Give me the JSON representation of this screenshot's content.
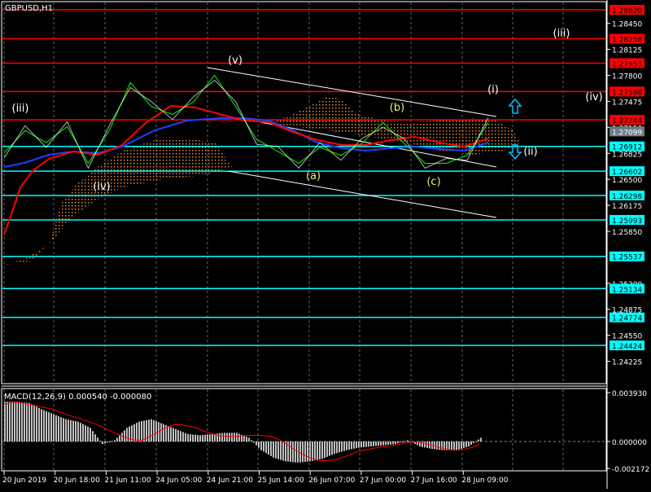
{
  "window": {
    "title": "GBPUSD,H1"
  },
  "colors": {
    "bg": "#000000",
    "grid": "#8a8a8a",
    "resistance": "#ff0000",
    "support": "#00ffff",
    "bid": "#6e7b87",
    "ma_fast": "#ff0000",
    "ma_slow": "#2040ff",
    "price": "#00ff00",
    "cloud": "#e8883a",
    "wave_primary": "#ffffff",
    "wave_minor": "#f0f070",
    "macd_hist": "#c0c0c0",
    "macd_signal": "#ff0000"
  },
  "price_axis": {
    "range": [
      1.2412,
      1.2874
    ],
    "ticks": [
      "1.28450",
      "1.28125",
      "1.27800",
      "1.27475",
      "1.27150",
      "1.26825",
      "1.26500",
      "1.26175",
      "1.25850",
      "1.25200",
      "1.24875",
      "1.24550",
      "1.24225"
    ],
    "resistance_levels": [
      "1.28620",
      "1.28258",
      "1.27953",
      "1.27598",
      "1.27244"
    ],
    "current_price": "1.27099",
    "support_levels": [
      "1.26912",
      "1.26602",
      "1.26298",
      "1.25993",
      "1.25537",
      "1.25134",
      "1.24774",
      "1.24424"
    ]
  },
  "wave_labels": [
    {
      "text": "(iii)",
      "style": "primary"
    },
    {
      "text": "(iv)",
      "style": "primary"
    },
    {
      "text": "(v)",
      "style": "primary"
    },
    {
      "text": "(a)",
      "style": "minor"
    },
    {
      "text": "(b)",
      "style": "minor"
    },
    {
      "text": "(c)",
      "style": "minor"
    },
    {
      "text": "(i)",
      "style": "primary"
    },
    {
      "text": "(ii)",
      "style": "primary"
    },
    {
      "text": "(iii)",
      "style": "primary"
    },
    {
      "text": "(iv)",
      "style": "primary"
    }
  ],
  "chart_data": {
    "type": "line",
    "symbol": "GBPUSD",
    "timeframe": "H1",
    "price_close_samples": [
      1.2683,
      1.2711,
      1.2696,
      1.2716,
      1.267,
      1.2711,
      1.2771,
      1.2741,
      1.2731,
      1.2747,
      1.278,
      1.2741,
      1.27,
      1.2685,
      1.267,
      1.269,
      1.268,
      1.2695,
      1.2721,
      1.2695,
      1.267,
      1.267,
      1.268,
      1.2721
    ],
    "x_labels": [
      "20 Jun 2019",
      "20 Jun 18:00",
      "21 Jun 11:00",
      "24 Jun 05:00",
      "24 Jun 21:00",
      "25 Jun 14:00",
      "26 Jun 07:00",
      "27 Jun 00:00",
      "27 Jun 16:00",
      "28 Jun 09:00"
    ]
  },
  "macd": {
    "title": "MACD(12,26,9) 0.000540 -0.000080",
    "axis_labels": [
      "0.003930",
      "0.000000",
      "-0.002172"
    ],
    "range": [
      -0.002172,
      0.00393
    ],
    "histogram_samples": [
      0.0032,
      0.0032,
      0.0031,
      0.0026,
      0.0022,
      0.0018,
      0.0016,
      0.0011,
      -0.0002,
      0.0001,
      0.0011,
      0.0016,
      0.0018,
      0.0014,
      0.001,
      0.0006,
      0.0005,
      0.0006,
      0.0007,
      0.0007,
      0.0003,
      -0.0007,
      -0.0013,
      -0.0016,
      -0.0017,
      -0.0016,
      -0.0014,
      -0.001,
      -0.0007,
      -0.0005,
      -0.0004,
      -0.0003,
      -0.0002,
      0.0001,
      -0.0004,
      -0.0006,
      -0.0007,
      -0.0007,
      -0.0004,
      0.0003
    ],
    "signal_samples": [
      0.003,
      0.0032,
      0.003,
      0.0028,
      0.0026,
      0.0022,
      0.0019,
      0.0016,
      0.0012,
      0.0007,
      0.0003,
      0.0,
      0.0004,
      0.001,
      0.0014,
      0.0013,
      0.001,
      0.0006,
      0.0004,
      0.0004,
      0.0005,
      0.0005,
      0.0004,
      -0.0001,
      -0.0008,
      -0.0013,
      -0.0016,
      -0.0015,
      -0.0012,
      -0.0008,
      -0.0006,
      -0.0004,
      -0.0003,
      -0.0001,
      0.0,
      -0.0003,
      -0.0006,
      -0.0007,
      -0.0006,
      -0.0002
    ]
  }
}
